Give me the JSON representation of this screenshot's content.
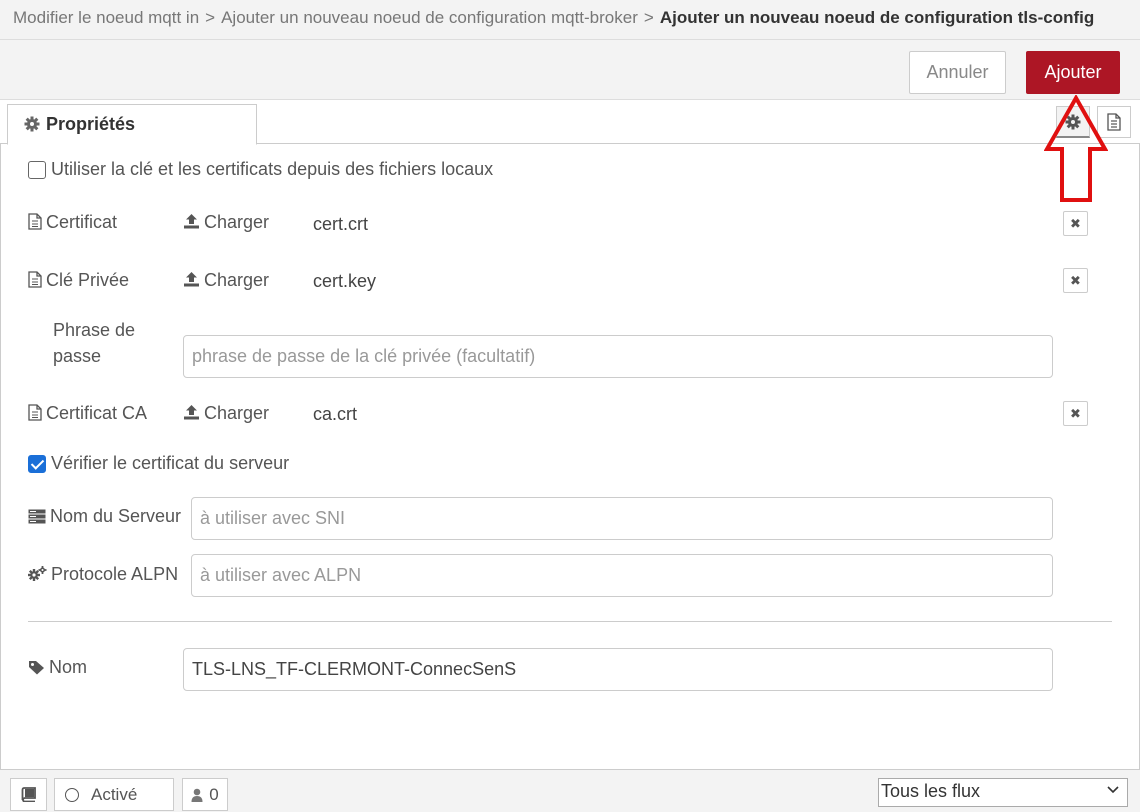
{
  "breadcrumb": {
    "items": [
      "Modifier le noeud mqtt in",
      "Ajouter un nouveau noeud de configuration mqtt-broker"
    ],
    "separator": ">",
    "current": "Ajouter un nouveau noeud de configuration tls-config"
  },
  "toolbar": {
    "cancel_label": "Annuler",
    "add_label": "Ajouter",
    "add_color": "#ad1625"
  },
  "tabs": {
    "properties_label": "Propriétés"
  },
  "form": {
    "local_files_label": "Utiliser la clé et les certificats depuis des fichiers locaux",
    "local_files_checked": false,
    "certificate": {
      "label": "Certificat",
      "upload_label": "Charger",
      "file": "cert.crt"
    },
    "private_key": {
      "label": "Clé Privée",
      "upload_label": "Charger",
      "file": "cert.key"
    },
    "passphrase": {
      "label_line1": "Phrase de",
      "label_line2": "passe",
      "placeholder": "phrase de passe de la clé privée (facultatif)"
    },
    "ca_certificate": {
      "label": "Certificat CA",
      "upload_label": "Charger",
      "file": "ca.crt"
    },
    "verify_label": "Vérifier le certificat du serveur",
    "verify_checked": true,
    "server_name": {
      "label": "Nom du Serveur",
      "placeholder": "à utiliser avec SNI"
    },
    "alpn": {
      "label": "Protocole ALPN",
      "placeholder": "à utiliser avec ALPN"
    },
    "name": {
      "label": "Nom",
      "value": "TLS-LNS_TF-CLERMONT-ConnecSenS"
    }
  },
  "footer": {
    "status_label": "Activé",
    "users_count": "0",
    "flux_select": "Tous les flux"
  },
  "icons": {
    "tab_settings": "gear-icon",
    "tab_description": "document-icon",
    "annotation": "red-arrow-up-icon"
  }
}
